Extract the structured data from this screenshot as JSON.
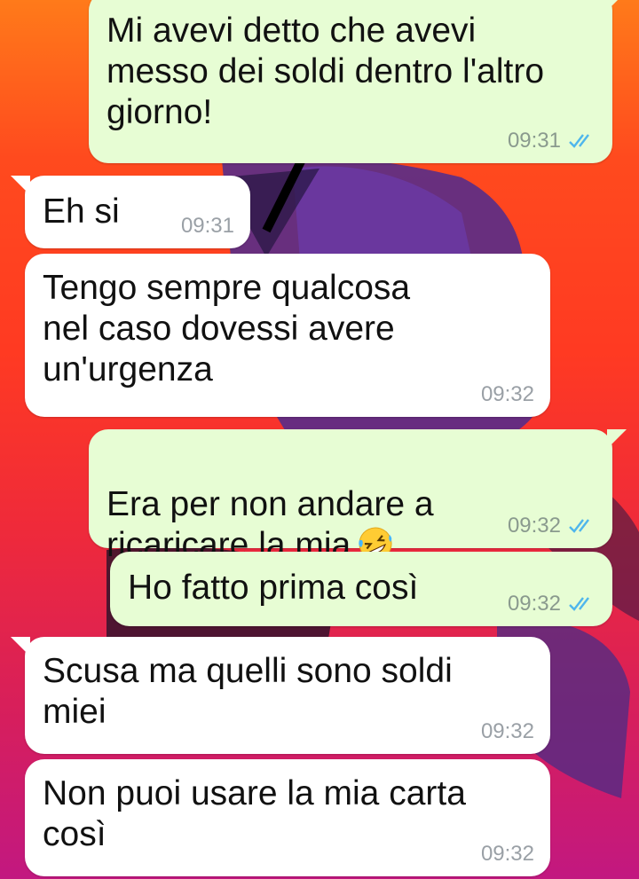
{
  "chat": {
    "messages": [
      {
        "id": "m1",
        "direction": "outgoing",
        "text": "Mi avevi detto che avevi\nmesso dei soldi dentro l'altro\ngiorno!",
        "time": "09:31",
        "status": "read"
      },
      {
        "id": "m2",
        "direction": "incoming",
        "text": "Eh si",
        "time": "09:31"
      },
      {
        "id": "m3",
        "direction": "incoming",
        "text": "Tengo sempre qualcosa\nnel caso dovessi avere\nun'urgenza",
        "time": "09:32"
      },
      {
        "id": "m4",
        "direction": "outgoing",
        "text": "Era per non andare a\nricaricare la mia",
        "emoji": "rolling-on-floor-laughing-emoji",
        "time": "09:32",
        "status": "read"
      },
      {
        "id": "m5",
        "direction": "outgoing",
        "text": "Ho fatto prima così",
        "time": "09:32",
        "status": "read"
      },
      {
        "id": "m6",
        "direction": "incoming",
        "text": "Scusa ma quelli sono soldi\nmiei",
        "time": "09:32"
      },
      {
        "id": "m7",
        "direction": "incoming",
        "text": "Non puoi usare la mia carta\ncosì",
        "time": "09:32"
      }
    ]
  },
  "colors": {
    "outgoing_bubble": "#e7fdd4",
    "incoming_bubble": "#ffffff",
    "read_ticks": "#4fb6ec",
    "wallpaper_top": "#ff7a1a",
    "wallpaper_bottom": "#c21880"
  }
}
